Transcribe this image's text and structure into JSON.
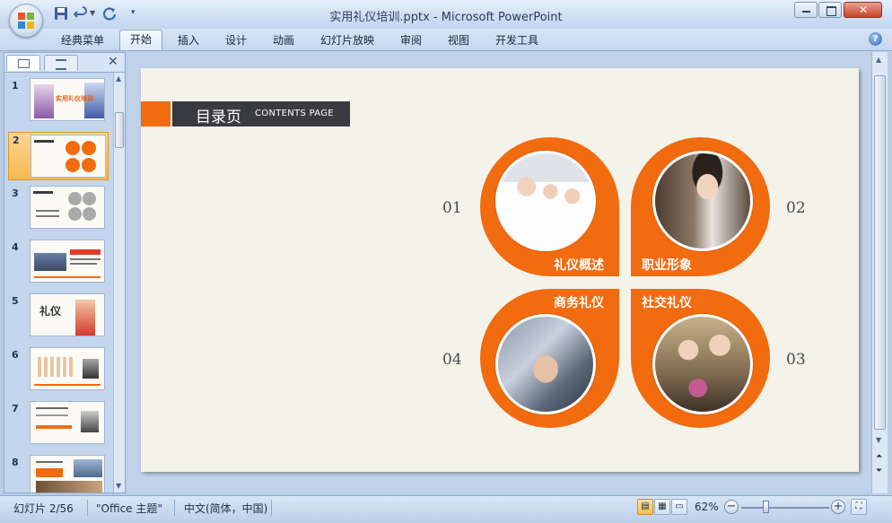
{
  "window": {
    "title": "实用礼仪培训.pptx - Microsoft PowerPoint"
  },
  "ribbon": {
    "tabs": [
      "经典菜单",
      "开始",
      "插入",
      "设计",
      "动画",
      "幻灯片放映",
      "审阅",
      "视图",
      "开发工具"
    ],
    "active_tab": "开始"
  },
  "slides_pane": {
    "thumbnails": [
      {
        "number": "1",
        "caption": "实用礼仪培训"
      },
      {
        "number": "2",
        "caption": ""
      },
      {
        "number": "3",
        "caption": ""
      },
      {
        "number": "4",
        "caption": ""
      },
      {
        "number": "5",
        "caption": "礼仪"
      },
      {
        "number": "6",
        "caption": ""
      },
      {
        "number": "7",
        "caption": ""
      },
      {
        "number": "8",
        "caption": ""
      }
    ],
    "selected": 2
  },
  "slide": {
    "title_cn": "目录页",
    "title_en": "CONTENTS PAGE",
    "sections": [
      {
        "number": "01",
        "label": "礼仪概述"
      },
      {
        "number": "02",
        "label": "职业形象"
      },
      {
        "number": "03",
        "label": "社交礼仪"
      },
      {
        "number": "04",
        "label": "商务礼仪"
      }
    ],
    "accent_color": "#f26b0f"
  },
  "status": {
    "slide_counter": "幻灯片 2/56",
    "theme": "\"Office 主题\"",
    "language": "中文(简体，中国)",
    "zoom": "62%"
  }
}
